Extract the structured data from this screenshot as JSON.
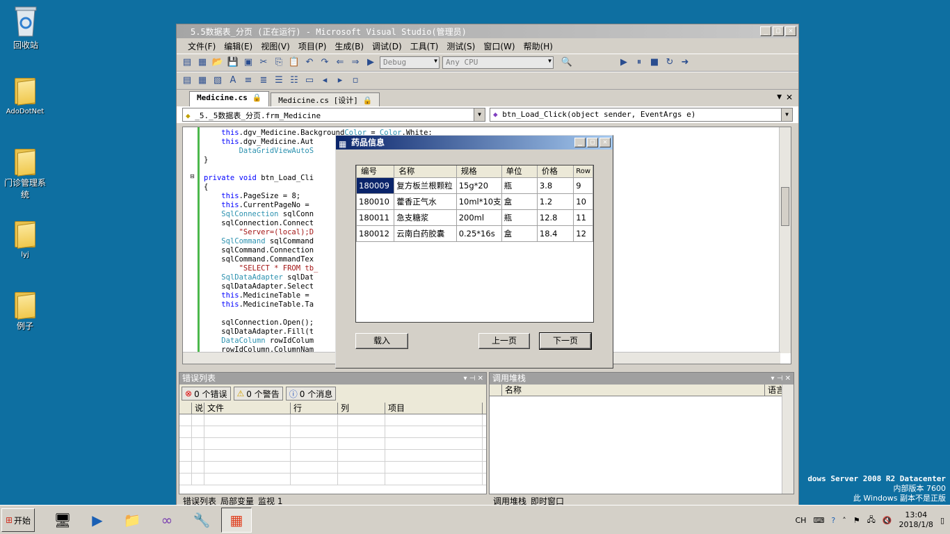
{
  "desktop": {
    "icons": [
      {
        "label": "回收站"
      },
      {
        "label": "AdoDotNet"
      },
      {
        "label": "门诊管理系统"
      },
      {
        "label": "lyj"
      },
      {
        "label": "例子"
      }
    ],
    "watermark": {
      "line1": "dows Server 2008 R2 Datacenter",
      "line2": "内部版本 7600",
      "line3": "此 Windows 副本不是正版"
    }
  },
  "vs": {
    "title": "5.5数据表_分页 (正在运行) - Microsoft Visual Studio(管理员)",
    "menu": [
      "文件(F)",
      "编辑(E)",
      "视图(V)",
      "项目(P)",
      "生成(B)",
      "调试(D)",
      "工具(T)",
      "测试(S)",
      "窗口(W)",
      "帮助(H)"
    ],
    "toolbar": {
      "config": "Debug",
      "platform": "Any CPU"
    },
    "tabs": [
      {
        "label": "Medicine.cs"
      },
      {
        "label": "Medicine.cs [设计]"
      }
    ],
    "nav": {
      "class": "_5._5数据表_分页.frm_Medicine",
      "member": "btn_Load_Click(object sender, EventArgs e)"
    },
    "code": [
      "    this.dgv_Medicine.BackgroundColor = Color.White;",
      "    this.dgv_Medicine.Aut",
      "        DataGridViewAutoS",
      "}",
      "",
      "private void btn_Load_Cli",
      "{",
      "    this.PageSize = 8;",
      "    this.CurrentPageNo =",
      "    SqlConnection sqlConn",
      "    sqlConnection.Connect",
      "        \"Server=(local);D",
      "    SqlCommand sqlCommand",
      "    sqlCommand.Connection",
      "    sqlCommand.CommandTex",
      "        \"SELECT * FROM tb_",
      "    SqlDataAdapter sqlDat",
      "    sqlDataAdapter.Select",
      "    this.MedicineTable =",
      "    this.MedicineTable.Ta",
      "",
      "    sqlConnection.Open();",
      "    sqlDataAdapter.Fill(t",
      "    DataColumn rowIdColum",
      "    rowIdColumn.ColumnNam"
    ],
    "error_list": {
      "title": "错误列表",
      "errors": "0 个错误",
      "warnings": "0 个警告",
      "messages": "0 个消息",
      "columns": [
        "说",
        "文件",
        "行",
        "列",
        "项目"
      ]
    },
    "call_stack": {
      "title": "调用堆栈",
      "columns": [
        "名称",
        "语言"
      ]
    },
    "bottom_tabs_left": [
      "错误列表",
      "局部变量",
      "监视 1"
    ],
    "bottom_tabs_right": [
      "调用堆栈",
      "即时窗口"
    ]
  },
  "dialog": {
    "title": "药品信息",
    "columns": [
      "编号",
      "名称",
      "规格",
      "单位",
      "价格",
      "Row"
    ],
    "rows": [
      [
        "180009",
        "复方板兰根颗粒",
        "15g*20",
        "瓶",
        "3.8",
        "9"
      ],
      [
        "180010",
        "藿香正气水",
        "10ml*10支",
        "盒",
        "1.2",
        "10"
      ],
      [
        "180011",
        "急支糖浆",
        "200ml",
        "瓶",
        "12.8",
        "11"
      ],
      [
        "180012",
        "云南白药胶囊",
        "0.25*16s",
        "盒",
        "18.4",
        "12"
      ]
    ],
    "buttons": {
      "load": "载入",
      "prev": "上一页",
      "next": "下一页"
    }
  },
  "taskbar": {
    "start": "开始",
    "lang": "CH",
    "time": "13:04",
    "date": "2018/1/8"
  }
}
